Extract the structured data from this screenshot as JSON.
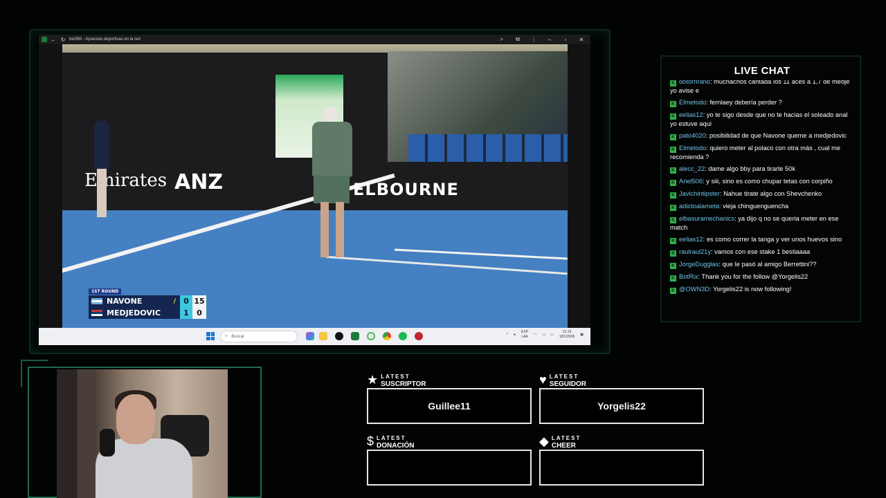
{
  "browser": {
    "title": "bet365 - Apuestas deportivas en la red"
  },
  "scoreboard": {
    "round": "1ST ROUND",
    "players": [
      {
        "name": "NAVONE",
        "set": "0",
        "points": "15",
        "serving": true
      },
      {
        "name": "MEDJEDOVIC",
        "set": "1",
        "points": "0",
        "serving": false
      }
    ]
  },
  "video": {
    "sponsor_left": "Emirates",
    "sponsor_mid": "ANZ",
    "sponsor_right": "ELBOURNE"
  },
  "taskbar": {
    "search_placeholder": "Buscar",
    "lang_top": "ESP",
    "lang_bottom": "LAA",
    "time": "21:13",
    "date": "18/1/2026"
  },
  "chat": {
    "title": "LIVE CHAT",
    "messages": [
      {
        "user": "dotorrirano",
        "text": "muchachos cantada los 11 aces a 1,7 de medje yo avise e"
      },
      {
        "user": "Elmetodo",
        "text": "fernlaey debería perder ?"
      },
      {
        "user": "eelias12",
        "text": "yo te sigo desde que no te hacias el soleado anal yo estuve aqui"
      },
      {
        "user": "pato4020",
        "text": "posibilidad de que Navone queme a medjedovic"
      },
      {
        "user": "Elmetodo",
        "text": "quiero meter al polaco con otra más , cual me recomienda ?"
      },
      {
        "user": "alecc_22",
        "text": "dame algo bby para tirarle 50k"
      },
      {
        "user": "Ariel506",
        "text": "y siii, sino es como chupar tetas con corpiño"
      },
      {
        "user": "Javichintipster",
        "text": "Nahue tirate algo con Shevchenko"
      },
      {
        "user": "adictoalameta",
        "text": "vieja chinguenguencha"
      },
      {
        "user": "elbasuramechanics",
        "text": "ya dijo q no se queria meter en ese match"
      },
      {
        "user": "eelias12",
        "text": "es como correr la tanga y ver unos huevos sino"
      },
      {
        "user": "raulraul21y",
        "text": "vamos con ese stake 1 bestiaaaa"
      },
      {
        "user": "JorgeDugglas",
        "text": "que le pasó al amigo Berrettini??"
      },
      {
        "user": "BotRix",
        "text": "Thank you for the follow @Yorgelis22"
      },
      {
        "user": "@OWN3D",
        "text": "Yorgelis22 is now following!"
      }
    ]
  },
  "alerts": {
    "suscriptor": {
      "small": "LATEST",
      "big": "SUSCRIPTOR",
      "value": "Guillee11",
      "icon": "star-icon"
    },
    "seguidor": {
      "small": "LATEST",
      "big": "SEGUIDOR",
      "value": "Yorgelis22",
      "icon": "heart-icon"
    },
    "donacion": {
      "small": "LATEST",
      "big": "DONACIÓN",
      "value": "",
      "icon": "dollar-icon"
    },
    "cheer": {
      "small": "LATEST",
      "big": "CHEER",
      "value": "",
      "icon": "diamond-icon"
    }
  },
  "colors": {
    "accent": "#1f6b4f",
    "chat_user": "#6fc3e8",
    "badge": "#2fb34a"
  }
}
